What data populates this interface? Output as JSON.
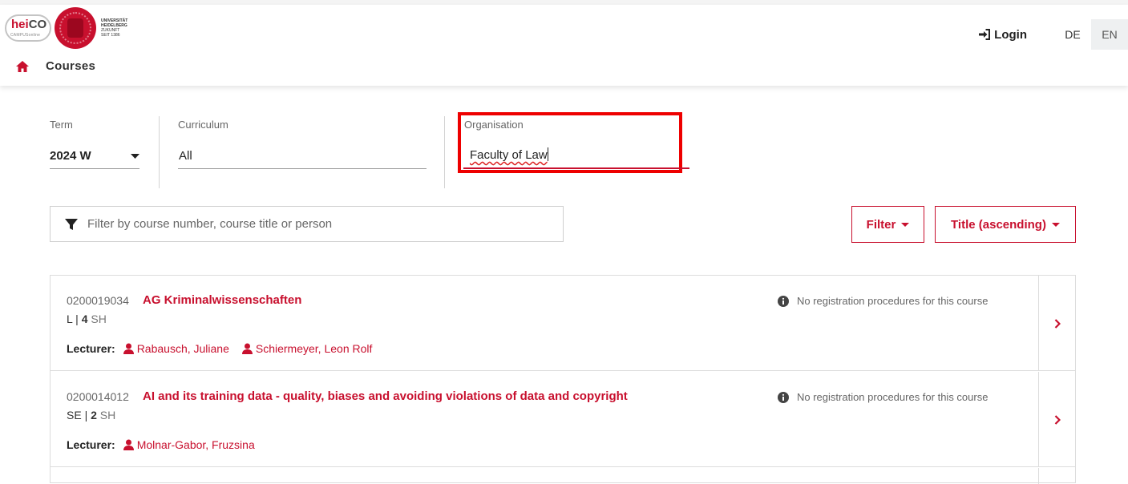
{
  "header": {
    "logo_heico_main": "heiCO",
    "logo_heico_sub": "CAMPUSonline",
    "logo_uni_lines": [
      "UNIVERSITÄT",
      "HEIDELBERG",
      "ZUKUNFT",
      "SEIT 1386"
    ],
    "login_label": "Login",
    "languages": [
      {
        "code": "DE",
        "active": false
      },
      {
        "code": "EN",
        "active": true
      }
    ],
    "breadcrumb": "Courses"
  },
  "filters": {
    "term": {
      "label": "Term",
      "value": "2024 W"
    },
    "curriculum": {
      "label": "Curriculum",
      "value": "All"
    },
    "organisation": {
      "label": "Organisation",
      "value": "Faculty of Law"
    }
  },
  "search": {
    "placeholder": "Filter by course number, course title or person"
  },
  "buttons": {
    "filter": "Filter",
    "sort": "Title (ascending)"
  },
  "courses": [
    {
      "number": "0200019034",
      "title": "AG Kriminalwissenschaften",
      "type": "L",
      "hours": "4",
      "unit": "SH",
      "lecturer_label": "Lecturer:",
      "lecturers": [
        "Rabausch, Juliane",
        "Schiermeyer, Leon Rolf"
      ],
      "registration": "No registration procedures for this course"
    },
    {
      "number": "0200014012",
      "title": "AI and its training data - quality, biases and avoiding violations of data and copyright",
      "type": "SE",
      "hours": "2",
      "unit": "SH",
      "lecturer_label": "Lecturer:",
      "lecturers": [
        "Molnar-Gabor, Fruzsina"
      ],
      "registration": "No registration procedures for this course"
    }
  ],
  "colors": {
    "accent": "#c8102e",
    "highlight_box": "#ee0000"
  }
}
